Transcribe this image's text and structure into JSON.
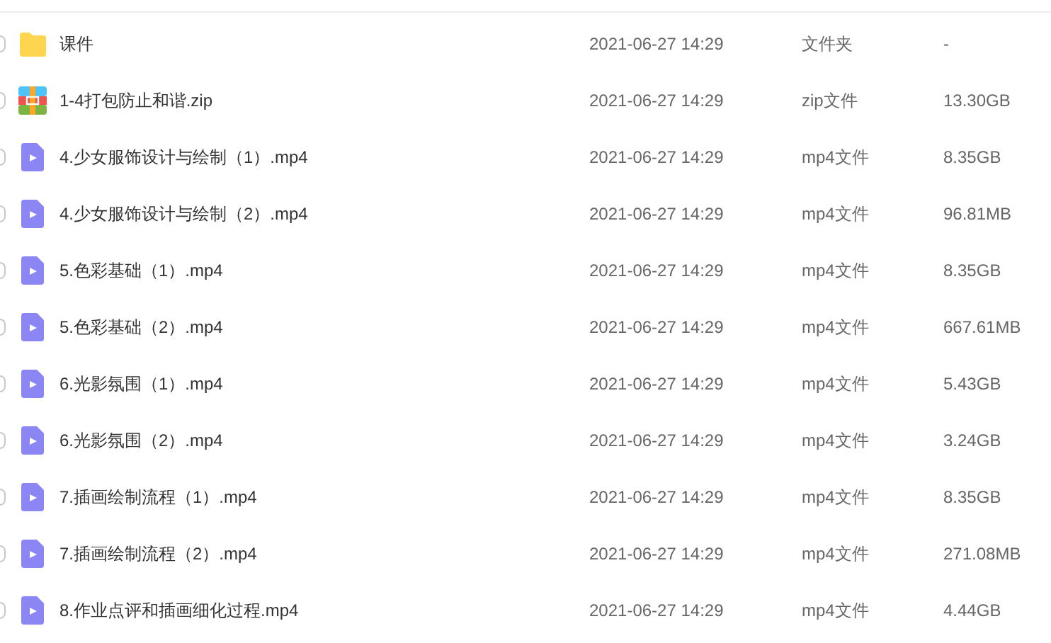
{
  "files": [
    {
      "kind": "folder",
      "name": "课件",
      "modified": "2021-06-27 14:29",
      "type": "文件夹",
      "size": "-",
      "checked": false
    },
    {
      "kind": "zip",
      "name": "1-4打包防止和谐.zip",
      "modified": "2021-06-27 14:29",
      "type": "zip文件",
      "size": "13.30GB",
      "checked": false
    },
    {
      "kind": "video",
      "name": "4.少女服饰设计与绘制（1）.mp4",
      "modified": "2021-06-27 14:29",
      "type": "mp4文件",
      "size": "8.35GB",
      "checked": false
    },
    {
      "kind": "video",
      "name": "4.少女服饰设计与绘制（2）.mp4",
      "modified": "2021-06-27 14:29",
      "type": "mp4文件",
      "size": "96.81MB",
      "checked": false
    },
    {
      "kind": "video",
      "name": "5.色彩基础（1）.mp4",
      "modified": "2021-06-27 14:29",
      "type": "mp4文件",
      "size": "8.35GB",
      "checked": false
    },
    {
      "kind": "video",
      "name": "5.色彩基础（2）.mp4",
      "modified": "2021-06-27 14:29",
      "type": "mp4文件",
      "size": "667.61MB",
      "checked": false
    },
    {
      "kind": "video",
      "name": "6.光影氛围（1）.mp4",
      "modified": "2021-06-27 14:29",
      "type": "mp4文件",
      "size": "5.43GB",
      "checked": false
    },
    {
      "kind": "video",
      "name": "6.光影氛围（2）.mp4",
      "modified": "2021-06-27 14:29",
      "type": "mp4文件",
      "size": "3.24GB",
      "checked": false
    },
    {
      "kind": "video",
      "name": "7.插画绘制流程（1）.mp4",
      "modified": "2021-06-27 14:29",
      "type": "mp4文件",
      "size": "8.35GB",
      "checked": false
    },
    {
      "kind": "video",
      "name": "7.插画绘制流程（2）.mp4",
      "modified": "2021-06-27 14:29",
      "type": "mp4文件",
      "size": "271.08MB",
      "checked": false
    },
    {
      "kind": "video",
      "name": "8.作业点评和插画细化过程.mp4",
      "modified": "2021-06-27 14:29",
      "type": "mp4文件",
      "size": "4.44GB",
      "checked": false
    }
  ]
}
